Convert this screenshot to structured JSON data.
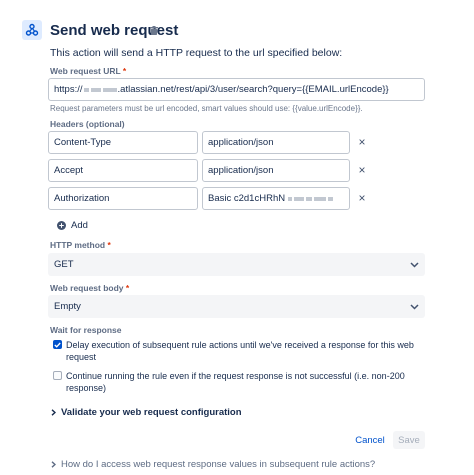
{
  "header": {
    "title": "Send web request",
    "description": "This action will send a HTTP request to the url specified below:"
  },
  "url": {
    "label": "Web request URL",
    "required_mark": "*",
    "value_prefix": "https://",
    "value_suffix": ".atlassian.net/rest/api/3/user/search?query={{EMAIL.urlEncode}}",
    "helper": "Request parameters must be url encoded, smart values should use: {{value.urlEncode}}."
  },
  "headers": {
    "label": "Headers (optional)",
    "rows": [
      {
        "key": "Content-Type",
        "value": "application/json"
      },
      {
        "key": "Accept",
        "value": "application/json"
      },
      {
        "key": "Authorization",
        "value": "Basic c2d1cHRhN"
      }
    ],
    "remove_symbol": "×",
    "add_label": "Add"
  },
  "method": {
    "label": "HTTP method",
    "required_mark": "*",
    "selected": "GET"
  },
  "body": {
    "label": "Web request body",
    "required_mark": "*",
    "selected": "Empty"
  },
  "wait": {
    "label": "Wait for response",
    "options": [
      {
        "text": "Delay execution of subsequent rule actions until we've received a response for this web request",
        "checked": true
      },
      {
        "text": "Continue running the rule even if the request response is not successful (i.e. non-200 response)",
        "checked": false
      }
    ]
  },
  "validate_label": "Validate your web request configuration",
  "footer": {
    "cancel_label": "Cancel",
    "save_label": "Save"
  },
  "faq_label": "How do I access web request response values in subsequent rule actions?",
  "colors": {
    "primary": "#0052cc",
    "required": "#de350b",
    "text": "#172b4d",
    "subtle": "#5e6c84"
  }
}
